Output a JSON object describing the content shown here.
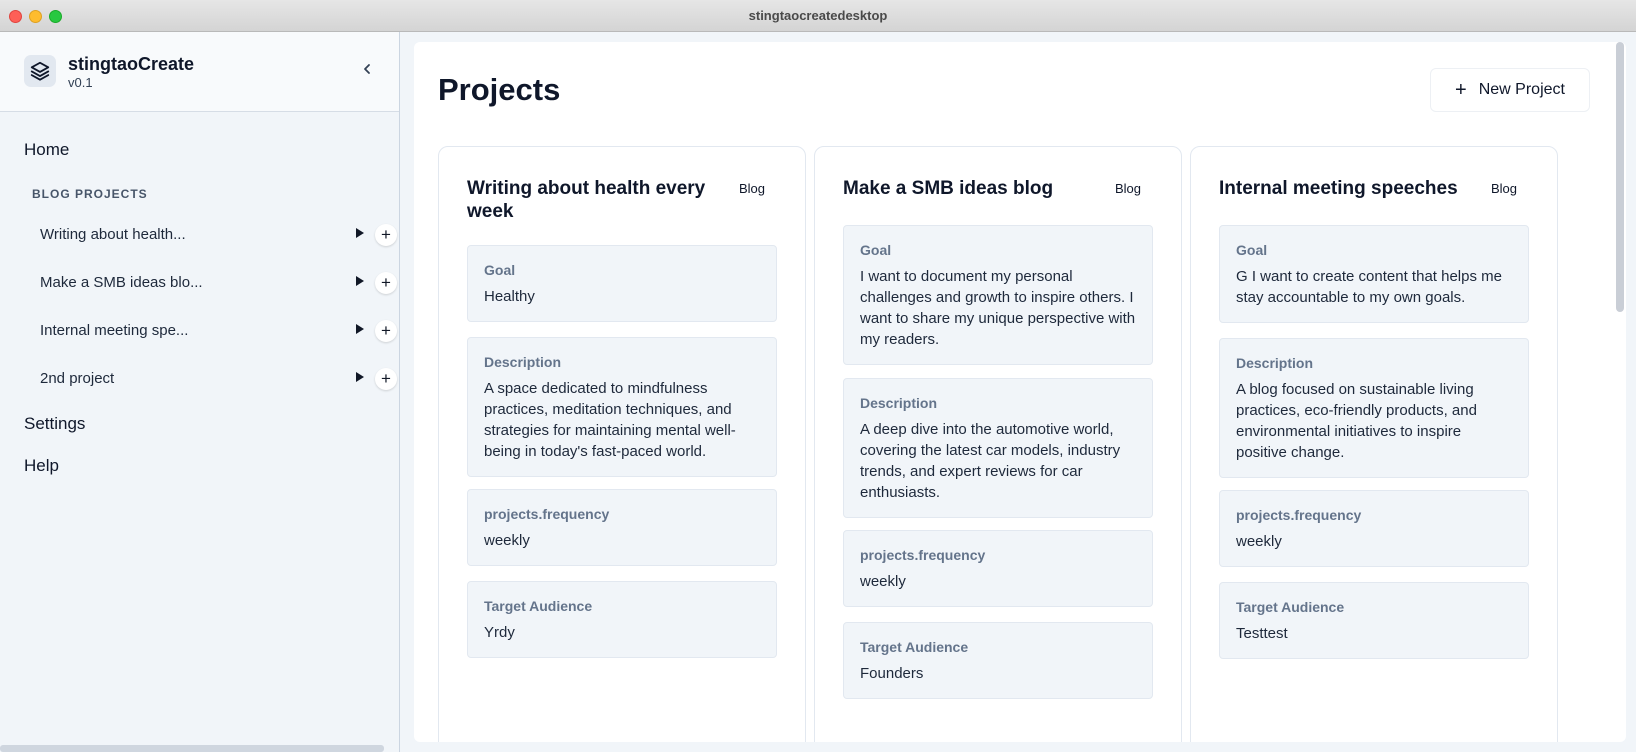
{
  "window": {
    "title": "stingtaocreatedesktop"
  },
  "sidebar": {
    "app_name": "stingtaoCreate",
    "app_version": "v0.1",
    "nav": {
      "home": "Home",
      "settings": "Settings",
      "help": "Help"
    },
    "section_label": "BLOG PROJECTS",
    "projects": [
      {
        "label": "Writing about health..."
      },
      {
        "label": "Make a SMB ideas blo..."
      },
      {
        "label": "Internal meeting spe..."
      },
      {
        "label": "2nd project"
      }
    ],
    "add_symbol": "+"
  },
  "main": {
    "title": "Projects",
    "new_project_label": "New Project",
    "new_project_symbol": "+",
    "cards": [
      {
        "title": "Writing about health every week",
        "tag": "Blog",
        "fields": [
          {
            "label": "Goal",
            "value": "Healthy"
          },
          {
            "label": "Description",
            "value": "A space dedicated to mindfulness practices, meditation techniques, and strategies for maintaining mental well-being in today's fast-paced world."
          },
          {
            "label": "projects.frequency",
            "value": "weekly"
          },
          {
            "label": "Target Audience",
            "value": "Yrdy"
          }
        ]
      },
      {
        "title": "Make a SMB ideas blog",
        "tag": "Blog",
        "fields": [
          {
            "label": "Goal",
            "value": "I want to document my personal challenges and growth to inspire others. I want to share my unique perspective with my readers."
          },
          {
            "label": "Description",
            "value": "A deep dive into the automotive world, covering the latest car models, industry trends, and expert reviews for car enthusiasts."
          },
          {
            "label": "projects.frequency",
            "value": "weekly"
          },
          {
            "label": "Target Audience",
            "value": "Founders"
          }
        ]
      },
      {
        "title": "Internal meeting speeches",
        "tag": "Blog",
        "fields": [
          {
            "label": "Goal",
            "value": "G I want to create content that helps me stay accountable to my own goals."
          },
          {
            "label": "Description",
            "value": "A blog focused on sustainable living practices, eco-friendly products, and environmental initiatives to inspire positive change."
          },
          {
            "label": "projects.frequency",
            "value": "weekly"
          },
          {
            "label": "Target Audience",
            "value": "Testtest"
          }
        ]
      }
    ]
  }
}
